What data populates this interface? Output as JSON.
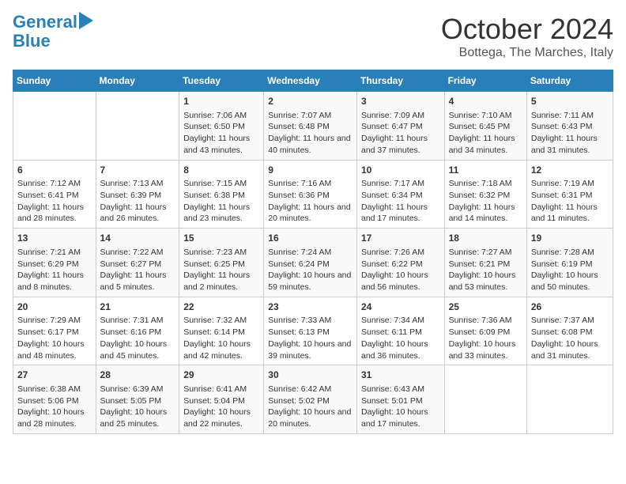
{
  "header": {
    "logo_line1": "General",
    "logo_line2": "Blue",
    "month": "October 2024",
    "location": "Bottega, The Marches, Italy"
  },
  "days_of_week": [
    "Sunday",
    "Monday",
    "Tuesday",
    "Wednesday",
    "Thursday",
    "Friday",
    "Saturday"
  ],
  "weeks": [
    [
      {
        "day": "",
        "content": ""
      },
      {
        "day": "",
        "content": ""
      },
      {
        "day": "1",
        "content": "Sunrise: 7:06 AM\nSunset: 6:50 PM\nDaylight: 11 hours and 43 minutes."
      },
      {
        "day": "2",
        "content": "Sunrise: 7:07 AM\nSunset: 6:48 PM\nDaylight: 11 hours and 40 minutes."
      },
      {
        "day": "3",
        "content": "Sunrise: 7:09 AM\nSunset: 6:47 PM\nDaylight: 11 hours and 37 minutes."
      },
      {
        "day": "4",
        "content": "Sunrise: 7:10 AM\nSunset: 6:45 PM\nDaylight: 11 hours and 34 minutes."
      },
      {
        "day": "5",
        "content": "Sunrise: 7:11 AM\nSunset: 6:43 PM\nDaylight: 11 hours and 31 minutes."
      }
    ],
    [
      {
        "day": "6",
        "content": "Sunrise: 7:12 AM\nSunset: 6:41 PM\nDaylight: 11 hours and 28 minutes."
      },
      {
        "day": "7",
        "content": "Sunrise: 7:13 AM\nSunset: 6:39 PM\nDaylight: 11 hours and 26 minutes."
      },
      {
        "day": "8",
        "content": "Sunrise: 7:15 AM\nSunset: 6:38 PM\nDaylight: 11 hours and 23 minutes."
      },
      {
        "day": "9",
        "content": "Sunrise: 7:16 AM\nSunset: 6:36 PM\nDaylight: 11 hours and 20 minutes."
      },
      {
        "day": "10",
        "content": "Sunrise: 7:17 AM\nSunset: 6:34 PM\nDaylight: 11 hours and 17 minutes."
      },
      {
        "day": "11",
        "content": "Sunrise: 7:18 AM\nSunset: 6:32 PM\nDaylight: 11 hours and 14 minutes."
      },
      {
        "day": "12",
        "content": "Sunrise: 7:19 AM\nSunset: 6:31 PM\nDaylight: 11 hours and 11 minutes."
      }
    ],
    [
      {
        "day": "13",
        "content": "Sunrise: 7:21 AM\nSunset: 6:29 PM\nDaylight: 11 hours and 8 minutes."
      },
      {
        "day": "14",
        "content": "Sunrise: 7:22 AM\nSunset: 6:27 PM\nDaylight: 11 hours and 5 minutes."
      },
      {
        "day": "15",
        "content": "Sunrise: 7:23 AM\nSunset: 6:25 PM\nDaylight: 11 hours and 2 minutes."
      },
      {
        "day": "16",
        "content": "Sunrise: 7:24 AM\nSunset: 6:24 PM\nDaylight: 10 hours and 59 minutes."
      },
      {
        "day": "17",
        "content": "Sunrise: 7:26 AM\nSunset: 6:22 PM\nDaylight: 10 hours and 56 minutes."
      },
      {
        "day": "18",
        "content": "Sunrise: 7:27 AM\nSunset: 6:21 PM\nDaylight: 10 hours and 53 minutes."
      },
      {
        "day": "19",
        "content": "Sunrise: 7:28 AM\nSunset: 6:19 PM\nDaylight: 10 hours and 50 minutes."
      }
    ],
    [
      {
        "day": "20",
        "content": "Sunrise: 7:29 AM\nSunset: 6:17 PM\nDaylight: 10 hours and 48 minutes."
      },
      {
        "day": "21",
        "content": "Sunrise: 7:31 AM\nSunset: 6:16 PM\nDaylight: 10 hours and 45 minutes."
      },
      {
        "day": "22",
        "content": "Sunrise: 7:32 AM\nSunset: 6:14 PM\nDaylight: 10 hours and 42 minutes."
      },
      {
        "day": "23",
        "content": "Sunrise: 7:33 AM\nSunset: 6:13 PM\nDaylight: 10 hours and 39 minutes."
      },
      {
        "day": "24",
        "content": "Sunrise: 7:34 AM\nSunset: 6:11 PM\nDaylight: 10 hours and 36 minutes."
      },
      {
        "day": "25",
        "content": "Sunrise: 7:36 AM\nSunset: 6:09 PM\nDaylight: 10 hours and 33 minutes."
      },
      {
        "day": "26",
        "content": "Sunrise: 7:37 AM\nSunset: 6:08 PM\nDaylight: 10 hours and 31 minutes."
      }
    ],
    [
      {
        "day": "27",
        "content": "Sunrise: 6:38 AM\nSunset: 5:06 PM\nDaylight: 10 hours and 28 minutes."
      },
      {
        "day": "28",
        "content": "Sunrise: 6:39 AM\nSunset: 5:05 PM\nDaylight: 10 hours and 25 minutes."
      },
      {
        "day": "29",
        "content": "Sunrise: 6:41 AM\nSunset: 5:04 PM\nDaylight: 10 hours and 22 minutes."
      },
      {
        "day": "30",
        "content": "Sunrise: 6:42 AM\nSunset: 5:02 PM\nDaylight: 10 hours and 20 minutes."
      },
      {
        "day": "31",
        "content": "Sunrise: 6:43 AM\nSunset: 5:01 PM\nDaylight: 10 hours and 17 minutes."
      },
      {
        "day": "",
        "content": ""
      },
      {
        "day": "",
        "content": ""
      }
    ]
  ]
}
